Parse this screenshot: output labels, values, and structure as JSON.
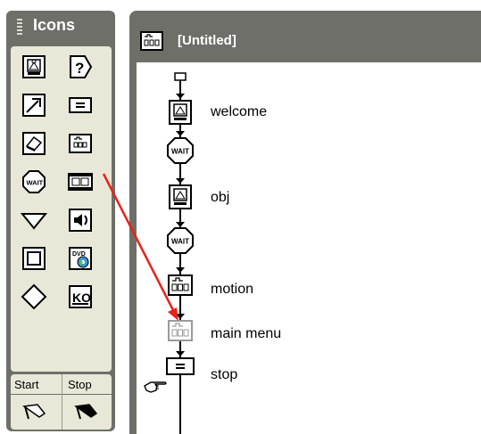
{
  "palette": {
    "title": "Icons",
    "start_label": "Start",
    "stop_label": "Stop",
    "tools": [
      {
        "name": "display-icon"
      },
      {
        "name": "interaction-icon"
      },
      {
        "name": "motion-icon"
      },
      {
        "name": "calculation-icon"
      },
      {
        "name": "erase-icon"
      },
      {
        "name": "map-icon"
      },
      {
        "name": "wait-icon"
      },
      {
        "name": "digital-movie-icon"
      },
      {
        "name": "decision-icon"
      },
      {
        "name": "sound-icon"
      },
      {
        "name": "framework-icon"
      },
      {
        "name": "video-icon"
      },
      {
        "name": "navigate-icon"
      },
      {
        "name": "knowledge-object-icon"
      }
    ]
  },
  "window": {
    "title": "[Untitled]"
  },
  "flow": {
    "nodes": [
      {
        "type": "display",
        "label": "welcome"
      },
      {
        "type": "wait",
        "label": ""
      },
      {
        "type": "display",
        "label": "obj"
      },
      {
        "type": "wait",
        "label": ""
      },
      {
        "type": "map",
        "label": "motion"
      },
      {
        "type": "map-ghost",
        "label": "main menu"
      },
      {
        "type": "calculation",
        "label": "stop"
      }
    ]
  },
  "colors": {
    "drag_arrow": "#e8231b",
    "panel_gray": "#6f6f6a",
    "palette_bg": "#e9e8d8"
  }
}
